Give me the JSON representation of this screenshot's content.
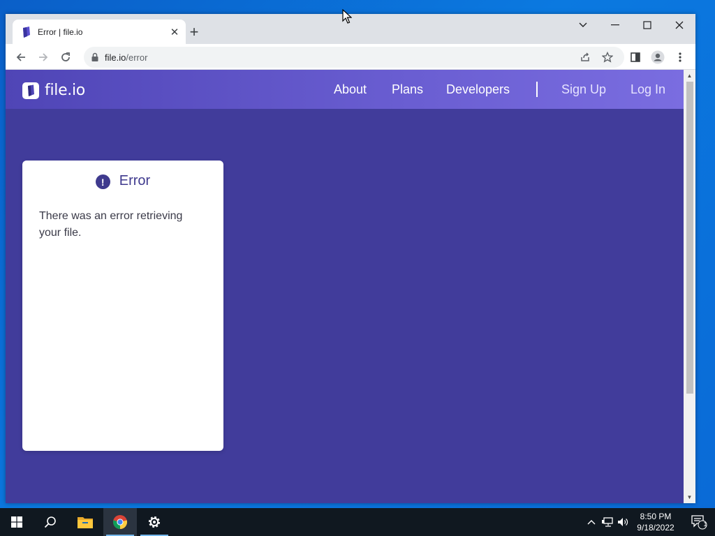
{
  "browser": {
    "tab_title": "Error | file.io",
    "url_host": "file.io",
    "url_path": "/error"
  },
  "site": {
    "logo_text": "file.io",
    "nav": {
      "about": "About",
      "plans": "Plans",
      "developers": "Developers",
      "sign_up": "Sign Up",
      "log_in": "Log In"
    },
    "card": {
      "title": "Error",
      "message": "There was an error retrieving your file.",
      "icon": "!"
    }
  },
  "taskbar": {
    "time": "8:50 PM",
    "date": "9/18/2022",
    "notification_count": "1"
  },
  "colors": {
    "page_background": "#413c9b",
    "nav_gradient_start": "#4f45b6",
    "nav_gradient_end": "#7a6de0",
    "card_accent": "#3f3a8e"
  },
  "icons": [
    "start-icon",
    "search-icon",
    "file-explorer-icon",
    "chrome-icon",
    "settings-icon",
    "chevron-up-icon",
    "network-icon",
    "volume-icon",
    "notification-icon"
  ]
}
